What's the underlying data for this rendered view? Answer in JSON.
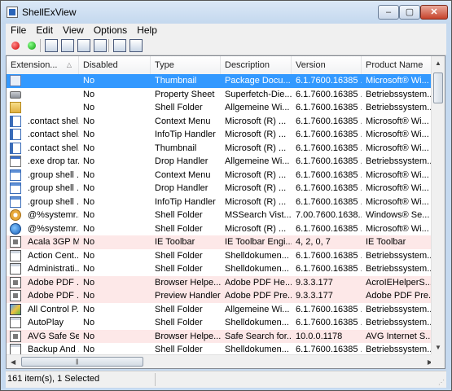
{
  "window": {
    "title": "ShellExView"
  },
  "menu": [
    "File",
    "Edit",
    "View",
    "Options",
    "Help"
  ],
  "toolbar": [
    {
      "name": "disable-icon",
      "label": ""
    },
    {
      "name": "enable-icon",
      "label": ""
    },
    {
      "name": "save-icon",
      "label": ""
    },
    {
      "name": "refresh-icon",
      "label": ""
    },
    {
      "name": "copy-icon",
      "label": ""
    },
    {
      "name": "properties-icon",
      "label": ""
    },
    {
      "name": "find-icon",
      "label": ""
    },
    {
      "name": "exit-icon",
      "label": ""
    }
  ],
  "columns": [
    "Extension...",
    "Disabled",
    "Type",
    "Description",
    "Version",
    "Product Name"
  ],
  "rows": [
    {
      "ext": "",
      "disabled": "No",
      "type": "Thumbnail",
      "desc": "Package Docu...",
      "version": "6.1.7600.16385 ...",
      "product": "Microsoft® Wi...",
      "icon": "page-icon",
      "selected": true
    },
    {
      "ext": "",
      "disabled": "No",
      "type": "Property Sheet",
      "desc": "Superfetch-Die...",
      "version": "6.1.7600.16385 ...",
      "product": "Betriebssystem...",
      "icon": "drive-icon"
    },
    {
      "ext": "",
      "disabled": "No",
      "type": "Shell Folder",
      "desc": "Allgemeine Wi...",
      "version": "6.1.7600.16385 ...",
      "product": "Betriebssystem...",
      "icon": "folder-icon"
    },
    {
      "ext": ".contact shel...",
      "disabled": "No",
      "type": "Context Menu",
      "desc": "Microsoft (R) ...",
      "version": "6.1.7600.16385 ...",
      "product": "Microsoft® Wi...",
      "icon": "contact-icon"
    },
    {
      "ext": ".contact shel...",
      "disabled": "No",
      "type": "InfoTip Handler",
      "desc": "Microsoft (R) ...",
      "version": "6.1.7600.16385 ...",
      "product": "Microsoft® Wi...",
      "icon": "contact-icon"
    },
    {
      "ext": ".contact shel...",
      "disabled": "No",
      "type": "Thumbnail",
      "desc": "Microsoft (R) ...",
      "version": "6.1.7600.16385 ...",
      "product": "Microsoft® Wi...",
      "icon": "contact-icon"
    },
    {
      "ext": ".exe drop tar...",
      "disabled": "No",
      "type": "Drop Handler",
      "desc": "Allgemeine Wi...",
      "version": "6.1.7600.16385 ...",
      "product": "Betriebssystem...",
      "icon": "exe-icon"
    },
    {
      "ext": ".group shell ...",
      "disabled": "No",
      "type": "Context Menu",
      "desc": "Microsoft (R) ...",
      "version": "6.1.7600.16385 ...",
      "product": "Microsoft® Wi...",
      "icon": "group-icon"
    },
    {
      "ext": ".group shell ...",
      "disabled": "No",
      "type": "Drop Handler",
      "desc": "Microsoft (R) ...",
      "version": "6.1.7600.16385 ...",
      "product": "Microsoft® Wi...",
      "icon": "group-icon"
    },
    {
      "ext": ".group shell ...",
      "disabled": "No",
      "type": "InfoTip Handler",
      "desc": "Microsoft (R) ...",
      "version": "6.1.7600.16385 ...",
      "product": "Microsoft® Wi...",
      "icon": "group-icon"
    },
    {
      "ext": "@%systemr...",
      "disabled": "No",
      "type": "Shell Folder",
      "desc": "MSSearch Vist...",
      "version": "7.00.7600.1638...",
      "product": "Windows® Se...",
      "icon": "search-folder-icon"
    },
    {
      "ext": "@%systemr...",
      "disabled": "No",
      "type": "Shell Folder",
      "desc": "Microsoft (R) ...",
      "version": "6.1.7600.16385 ...",
      "product": "Microsoft® Wi...",
      "icon": "globe-folder-icon"
    },
    {
      "ext": "Acala 3GP M...",
      "disabled": "No",
      "type": "IE Toolbar",
      "desc": "IE Toolbar Engi...",
      "version": "4, 2, 0, 7",
      "product": "IE Toolbar",
      "icon": "gear-icon",
      "pink": true
    },
    {
      "ext": "Action Cent...",
      "disabled": "No",
      "type": "Shell Folder",
      "desc": "Shelldokumen...",
      "version": "6.1.7600.16385 ...",
      "product": "Betriebssystem...",
      "icon": "doc-icon"
    },
    {
      "ext": "Administrati...",
      "disabled": "No",
      "type": "Shell Folder",
      "desc": "Shelldokumen...",
      "version": "6.1.7600.16385 ...",
      "product": "Betriebssystem...",
      "icon": "doc-icon"
    },
    {
      "ext": "Adobe PDF ...",
      "disabled": "No",
      "type": "Browser Helpe...",
      "desc": "Adobe PDF He...",
      "version": "9.3.3.177",
      "product": "AcroIEHelperS...",
      "icon": "gear-icon",
      "pink": true
    },
    {
      "ext": "Adobe PDF ...",
      "disabled": "No",
      "type": "Preview Handler",
      "desc": "Adobe PDF Pre...",
      "version": "9.3.3.177",
      "product": "Adobe PDF Pre...",
      "icon": "gear-icon",
      "pink": true
    },
    {
      "ext": "All Control P...",
      "disabled": "No",
      "type": "Shell Folder",
      "desc": "Allgemeine Wi...",
      "version": "6.1.7600.16385 ...",
      "product": "Betriebssystem...",
      "icon": "control-panel-icon"
    },
    {
      "ext": "AutoPlay",
      "disabled": "No",
      "type": "Shell Folder",
      "desc": "Shelldokumen...",
      "version": "6.1.7600.16385 ...",
      "product": "Betriebssystem...",
      "icon": "doc-icon"
    },
    {
      "ext": "AVG Safe Se...",
      "disabled": "No",
      "type": "Browser Helpe...",
      "desc": "Safe Search for...",
      "version": "10.0.0.1178",
      "product": "AVG Internet S...",
      "icon": "gear-icon",
      "pink": true
    },
    {
      "ext": "Backup And ...",
      "disabled": "No",
      "type": "Shell Folder",
      "desc": "Shelldokumen...",
      "version": "6.1.7600.16385 ...",
      "product": "Betriebssystem...",
      "icon": "doc-icon"
    }
  ],
  "status": {
    "text": "161 item(s), 1 Selected"
  },
  "colors": {
    "selected": "#3399ff",
    "pink": "#fde8e8",
    "chrome": "#c5d9ef"
  }
}
